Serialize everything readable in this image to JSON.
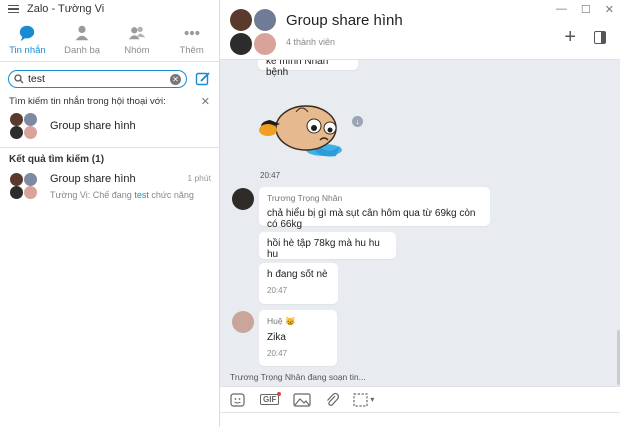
{
  "app": {
    "title": "Zalo - Tường Vi"
  },
  "nav": {
    "tabs": [
      {
        "label": "Tin nhắn",
        "icon": "chat-icon",
        "active": true
      },
      {
        "label": "Danh bạ",
        "icon": "contact-icon",
        "active": false
      },
      {
        "label": "Nhóm",
        "icon": "group-icon",
        "active": false
      },
      {
        "label": "Thêm",
        "icon": "more-icon",
        "active": false
      }
    ]
  },
  "search": {
    "value": "test",
    "placeholder": ""
  },
  "hint": {
    "text": "Tìm kiếm tin nhắn trong hội thoại với:"
  },
  "suggestion": {
    "name": "Group share hình"
  },
  "results": {
    "title": "Kết quả tìm kiếm (1)",
    "items": [
      {
        "name": "Group share hình",
        "time": "1 phút",
        "snippet_prefix": "Tường Vi: Chế đang ",
        "snippet_highlight": "test",
        "snippet_suffix": " chức năng"
      }
    ]
  },
  "chat": {
    "title": "Group share hình",
    "subtitle": "4 thành viên",
    "partial_message": "kể mình Nhân bệnh",
    "sticker_time": "20:47",
    "sender1": "Trương Trọng Nhân",
    "msg1": "chả hiểu bị gì mà sụt cân hôm qua từ 69kg còn có 66kg",
    "msg2": "hồi hè tập 78kg mà hu hu hu",
    "msg3": "h đang sốt nè",
    "msg3_time": "20:47",
    "sender2": "Huệ 😸",
    "msg4": "Zika",
    "msg4_time": "20:47",
    "typing": "Trương Trọng Nhân đang soạn tin..."
  },
  "colors": {
    "accent": "#1a8ad1",
    "chat_bg": "#e8ebef"
  }
}
